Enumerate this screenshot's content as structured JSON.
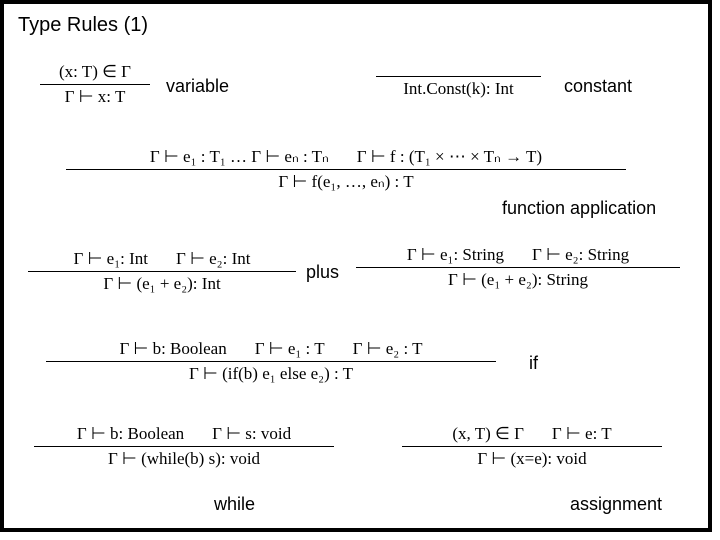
{
  "title": "Type Rules (1)",
  "labels": {
    "variable": "variable",
    "constant": "constant",
    "function_application": "function application",
    "plus": "plus",
    "if": "if",
    "while": "while",
    "assignment": "assignment"
  },
  "rules": {
    "variable": {
      "top": "(x: T) ∈ Γ",
      "bot": "Γ ⊢ x: T"
    },
    "constant": {
      "top": "",
      "bot": "Int.Const(k): Int"
    },
    "funcapp": {
      "top_left": "Γ ⊢ e₁ : T₁ … Γ ⊢ eₙ : Tₙ",
      "top_right": "Γ ⊢ f : (T₁ × ⋯ × Tₙ → T)",
      "bot": "Γ ⊢ f(e₁, …, eₙ) : T"
    },
    "plus_int": {
      "top_left": "Γ ⊢ e₁: Int",
      "top_right": "Γ ⊢ e₂: Int",
      "bot": "Γ ⊢ (e₁ + e₂): Int"
    },
    "plus_str": {
      "top_left": "Γ ⊢ e₁: String",
      "top_right": "Γ ⊢ e₂: String",
      "bot": "Γ ⊢ (e₁ + e₂): String"
    },
    "if": {
      "top_a": "Γ ⊢ b: Boolean",
      "top_b": "Γ ⊢ e₁ : T",
      "top_c": "Γ ⊢ e₂ : T",
      "bot": "Γ ⊢ (if(b) e₁ else e₂) : T"
    },
    "while": {
      "top_a": "Γ ⊢ b: Boolean",
      "top_b": "Γ ⊢ s: void",
      "bot": "Γ ⊢ (while(b) s): void"
    },
    "assign": {
      "top_a": "(x, T) ∈ Γ",
      "top_b": "Γ ⊢ e: T",
      "bot": "Γ ⊢ (x=e): void"
    }
  }
}
